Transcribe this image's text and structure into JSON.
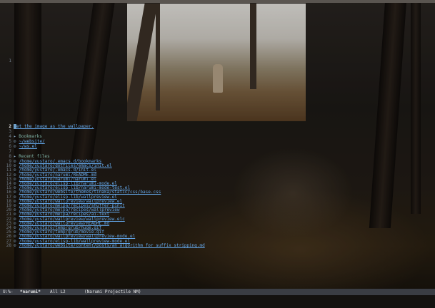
{
  "colors": {
    "link": "#63a6e8",
    "heading": "#7fb3a6",
    "modeline_bg": "#3a3d44",
    "modeline_fg": "#e4e4e4",
    "cursor": "#6fa0c8"
  },
  "editor": {
    "gutter_top": "1",
    "current_line": {
      "number": "2",
      "text": "et the image as the wallpaper."
    },
    "blank_line_num": "3",
    "bookmarks_num": "4",
    "bookmarks_heading": "Bookmarks",
    "bookmarks": [
      {
        "num": "5",
        "text": "~/website/"
      },
      {
        "num": "6",
        "text": "~/ws.el"
      }
    ],
    "blank2_num": "7",
    "recent_num": "8",
    "recent_heading": "Recent files",
    "recent_files": [
      {
        "num": "9",
        "text": "/home/yustaro/.emacs.d/bookmarks"
      },
      {
        "num": "10",
        "text": "/home/yustaro/dotfiles/emacs/init.el"
      },
      {
        "num": "11",
        "text": "/home/yustaro/.emacs.d/init.el"
      },
      {
        "num": "12",
        "text": "/home/yustaro/narumi/README.md"
      },
      {
        "num": "13",
        "text": "/home/yustaro/narumi/narumi.el"
      },
      {
        "num": "14",
        "text": "/home/yustaro/elisp-lib/narumi-mode.el"
      },
      {
        "num": "15",
        "text": "/home/yustaro/elisp-lib/narumi-mode-test.el"
      },
      {
        "num": "16",
        "text": "/home/yustaro/website/themes/tinaka/static/css/base.css"
      },
      {
        "num": "17",
        "text": "/home/yustaro/elisp-lib/wallpreview.el"
      },
      {
        "num": "18",
        "text": "/home/yustaro/wallpreview/wallpreview.el"
      },
      {
        "num": "19",
        "text": "/home/yustaro/melpa/recipes/shuffer-pinit"
      },
      {
        "num": "20",
        "text": "/home/yustaro/melpa/recipes/wallpreview"
      },
      {
        "num": "21",
        "text": "/home/yustaro/melpa/recipes/ai-text"
      },
      {
        "num": "22",
        "text": "/home/yustaro/wallpreview/wallpreview.elc"
      },
      {
        "num": "23",
        "text": "/home/yustaro/wallpreview/README.md"
      },
      {
        "num": "24",
        "text": "/home/yustaro/temp/grub/huge.gif"
      },
      {
        "num": "25",
        "text": "/home/yustaro/temp/grub/movie.gif"
      },
      {
        "num": "26",
        "text": "/home/yustaro/wallpreview/wallpreview-mode.el"
      },
      {
        "num": "27",
        "text": "/home/yustaro/elisp-lib/wallpreview-mode.el"
      },
      {
        "num": "28",
        "text": "/home/yustaro/website/content/posts/an_algorithm_for_suffix_stripping.md"
      }
    ]
  },
  "modeline": {
    "state": "U:%-",
    "buffer": "*narumi*",
    "position": "All L2",
    "mode": "(Narumi Projectile NM)"
  }
}
